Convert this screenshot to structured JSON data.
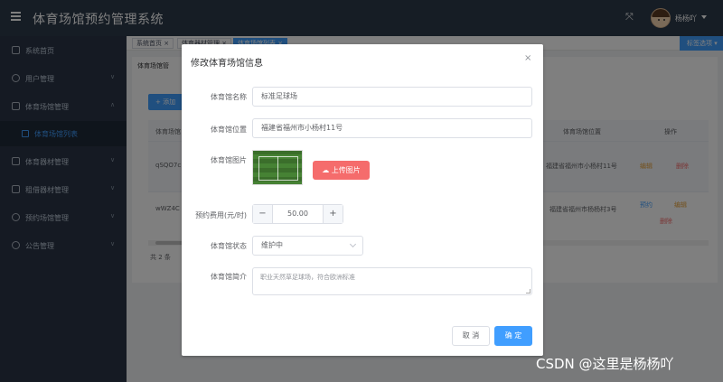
{
  "header": {
    "title": "体育场馆预约管理系统",
    "username": "杨杨吖"
  },
  "sidebar": {
    "items": [
      {
        "label": "系统首页"
      },
      {
        "label": "用户管理"
      },
      {
        "label": "体育场馆管理"
      },
      {
        "label": "体育场馆列表"
      },
      {
        "label": "体育器材管理"
      },
      {
        "label": "租借器材管理"
      },
      {
        "label": "预约场馆管理"
      },
      {
        "label": "公告管理"
      }
    ]
  },
  "tags": {
    "items": [
      {
        "label": "系统首页 ×"
      },
      {
        "label": "体育器材管理 ×"
      },
      {
        "label": "体育场馆列表 ×"
      }
    ],
    "right": "标签选项 ▾"
  },
  "page": {
    "breadcrumb": "体育场馆管",
    "add_label": "+ 添加",
    "table": {
      "col_name": "体育场馆",
      "col_location": "体育场馆位置",
      "col_ops": "操作",
      "rows": [
        {
          "id": "qSQO7c",
          "location": "福建省福州市小杨村11号"
        },
        {
          "id": "wWZ4C",
          "location": "福建省福州市杨杨村3号"
        }
      ],
      "op_reserve": "预约",
      "op_edit": "编辑",
      "op_delete": "删除"
    },
    "total": "共 2 条"
  },
  "dialog": {
    "title": "修改体育场馆信息",
    "fields": {
      "name_label": "体育馆名称",
      "name_value": "标准足球场",
      "location_label": "体育馆位置",
      "location_value": "福建省福州市小杨村11号",
      "image_label": "体育馆图片",
      "upload_label": "上传图片",
      "fee_label": "预约费用(元/时)",
      "fee_value": "50.00",
      "status_label": "体育馆状态",
      "status_value": "维护中",
      "intro_label": "体育馆简介",
      "intro_value": "职业天然草足球场，符合欧洲标准"
    },
    "cancel_label": "取 消",
    "ok_label": "确 定"
  },
  "watermark": "CSDN @这里是杨杨吖"
}
